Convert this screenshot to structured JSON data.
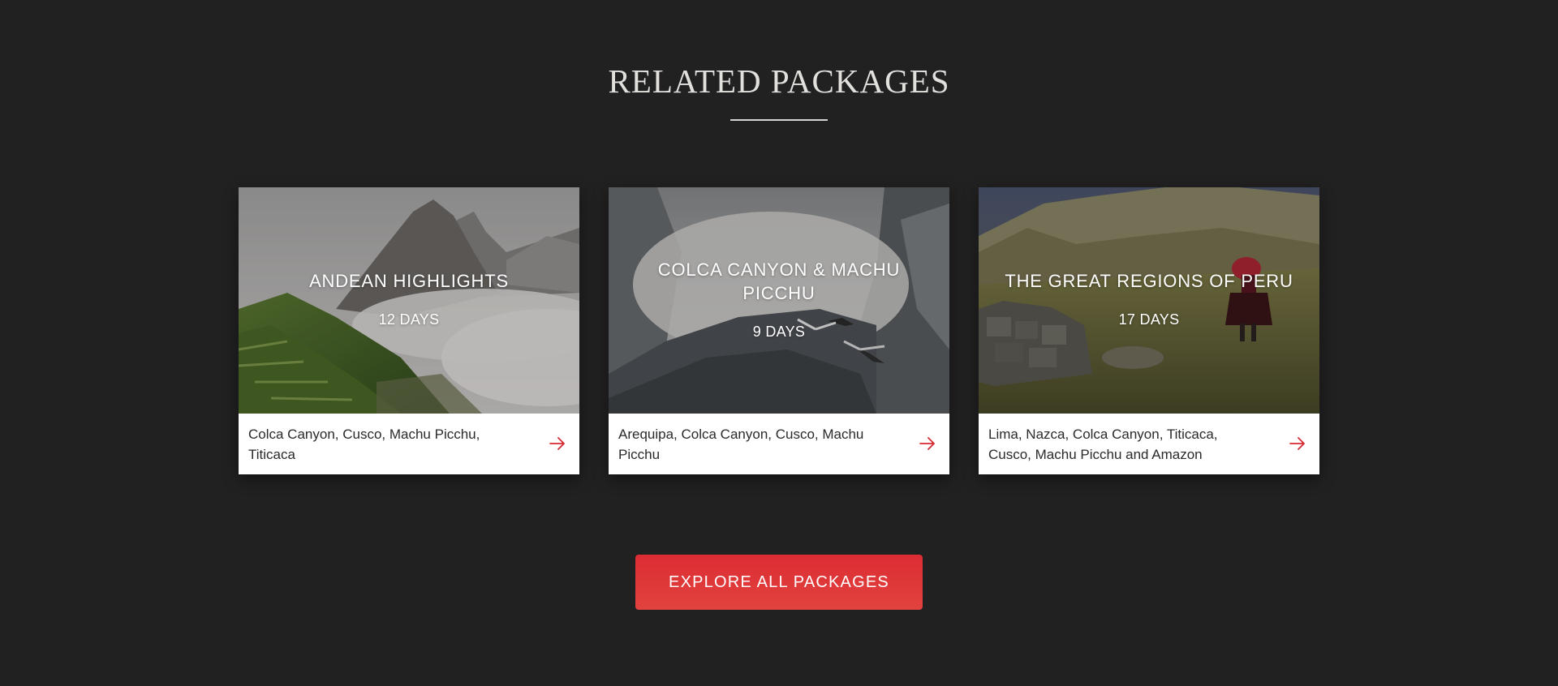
{
  "section": {
    "title": "RELATED PACKAGES"
  },
  "packages": [
    {
      "title": "ANDEAN HIGHLIGHTS",
      "duration": "12 DAYS",
      "destinations": "Colca Canyon, Cusco, Machu Picchu, Titicaca",
      "arrow_icon": "arrow-right-icon",
      "image": "machu-picchu-misty-mountains"
    },
    {
      "title": "COLCA CANYON & MACHU PICCHU",
      "duration": "9 DAYS",
      "destinations": "Arequipa, Colca Canyon, Cusco, Machu Picchu",
      "arrow_icon": "arrow-right-icon",
      "image": "condors-over-canyon"
    },
    {
      "title": "THE GREAT REGIONS OF PERU",
      "duration": "17 DAYS",
      "destinations": "Lima, Nazca, Colca Canyon, Titicaca, Cusco, Machu Picchu and Amazon",
      "arrow_icon": "arrow-right-icon",
      "image": "andean-highlands-woman"
    }
  ],
  "cta": {
    "label": "EXPLORE ALL PACKAGES"
  },
  "colors": {
    "background": "#222122",
    "accent": "#dc2c34",
    "card_footer": "#ffffff",
    "title": "#e2e0dd"
  }
}
